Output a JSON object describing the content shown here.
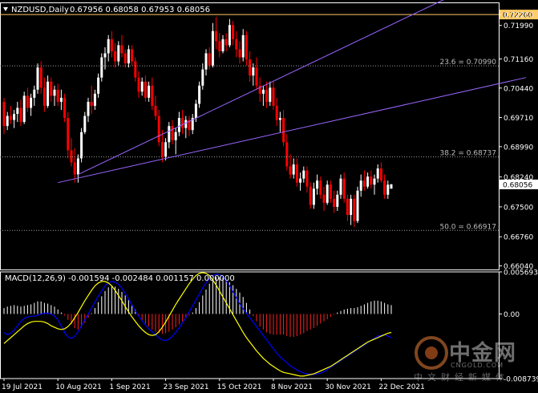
{
  "header": {
    "symbol_label": "NZDUSD,Daily",
    "ohlc_label": "0.67956 0.68058 0.67953 0.68056"
  },
  "macd_header": "MACD(12,26,9) -0.001594 -0.002484 0.001157 0.000000",
  "watermark": {
    "title": "中金网",
    "url": "CNGOLD.COM",
    "subtitle": "中文财经新媒体"
  },
  "colors": {
    "background": "#000000",
    "bull_candle": "#ffffff",
    "bear_candle": "#ff0000",
    "channel_line": "#9966ff",
    "resistance_line": "#ffcc66",
    "fib_line": "#a0a0a0",
    "macd_positive": "#ffffff",
    "macd_negative": "#ff2020",
    "macd_line": "#0000ff",
    "signal_line": "#ffff00",
    "axis_text": "#ffffff"
  },
  "chart_data": {
    "type": "candlestick",
    "price_axis": {
      "ticks": [
        "0.72260",
        "0.71990",
        "0.71160",
        "0.70440",
        "0.69710",
        "0.68990",
        "0.68240",
        "0.67500",
        "0.66760",
        "0.66040"
      ],
      "range": [
        0.6595,
        0.7254
      ]
    },
    "current_price": "0.68056",
    "resistance": {
      "value": 0.7226,
      "label": "0.72260"
    },
    "fib_levels": [
      {
        "label": "23.6 = 0.70990",
        "value": 0.7099
      },
      {
        "label": "38.2 = 0.68737",
        "value": 0.68737
      },
      {
        "label": "50.0 = 0.66917",
        "value": 0.66917
      }
    ],
    "date_labels": [
      "19 Jul 2021",
      "10 Aug 2021",
      "1 Sep 2021",
      "23 Sep 2021",
      "15 Oct 2021",
      "8 Nov 2021",
      "30 Nov 2021",
      "22 Dec 2021"
    ],
    "date_label_bars": [
      0,
      16,
      32,
      48,
      64,
      80,
      96,
      112
    ],
    "candles": [
      [
        0.701,
        0.702,
        0.693,
        0.695
      ],
      [
        0.695,
        0.6985,
        0.694,
        0.6975
      ],
      [
        0.6975,
        0.7,
        0.6955,
        0.6965
      ],
      [
        0.6965,
        0.699,
        0.6945,
        0.698
      ],
      [
        0.698,
        0.701,
        0.696,
        0.6995
      ],
      [
        0.6995,
        0.7015,
        0.695,
        0.696
      ],
      [
        0.696,
        0.7035,
        0.6955,
        0.7025
      ],
      [
        0.7025,
        0.7045,
        0.6985,
        0.6995
      ],
      [
        0.6995,
        0.703,
        0.6975,
        0.702
      ],
      [
        0.702,
        0.705,
        0.7,
        0.704
      ],
      [
        0.704,
        0.7105,
        0.703,
        0.7095
      ],
      [
        0.7095,
        0.711,
        0.703,
        0.7045
      ],
      [
        0.7045,
        0.707,
        0.6985,
        0.7
      ],
      [
        0.7,
        0.7075,
        0.6995,
        0.706
      ],
      [
        0.706,
        0.707,
        0.701,
        0.7025
      ],
      [
        0.7025,
        0.705,
        0.7,
        0.704
      ],
      [
        0.704,
        0.7055,
        0.7,
        0.701
      ],
      [
        0.701,
        0.704,
        0.699,
        0.702
      ],
      [
        0.702,
        0.703,
        0.696,
        0.697
      ],
      [
        0.697,
        0.6985,
        0.687,
        0.689
      ],
      [
        0.689,
        0.692,
        0.685,
        0.686
      ],
      [
        0.686,
        0.6895,
        0.681,
        0.683
      ],
      [
        0.683,
        0.688,
        0.681,
        0.687
      ],
      [
        0.687,
        0.6945,
        0.686,
        0.6935
      ],
      [
        0.6935,
        0.6985,
        0.693,
        0.6975
      ],
      [
        0.6975,
        0.702,
        0.696,
        0.701
      ],
      [
        0.701,
        0.705,
        0.698,
        0.7
      ],
      [
        0.7,
        0.704,
        0.699,
        0.703
      ],
      [
        0.703,
        0.708,
        0.702,
        0.707
      ],
      [
        0.707,
        0.713,
        0.706,
        0.712
      ],
      [
        0.712,
        0.7145,
        0.709,
        0.713
      ],
      [
        0.713,
        0.7175,
        0.711,
        0.7165
      ],
      [
        0.7165,
        0.7185,
        0.712,
        0.7135
      ],
      [
        0.7135,
        0.7155,
        0.7095,
        0.711
      ],
      [
        0.711,
        0.716,
        0.71,
        0.715
      ],
      [
        0.715,
        0.7175,
        0.712,
        0.713
      ],
      [
        0.713,
        0.714,
        0.7095,
        0.7105
      ],
      [
        0.7105,
        0.715,
        0.7095,
        0.714
      ],
      [
        0.714,
        0.715,
        0.71,
        0.711
      ],
      [
        0.711,
        0.712,
        0.706,
        0.707
      ],
      [
        0.707,
        0.7085,
        0.702,
        0.7035
      ],
      [
        0.7035,
        0.707,
        0.7025,
        0.706
      ],
      [
        0.706,
        0.7075,
        0.701,
        0.702
      ],
      [
        0.702,
        0.706,
        0.701,
        0.705
      ],
      [
        0.705,
        0.707,
        0.699,
        0.7
      ],
      [
        0.7,
        0.7025,
        0.6965,
        0.6975
      ],
      [
        0.6975,
        0.699,
        0.69,
        0.691
      ],
      [
        0.691,
        0.694,
        0.686,
        0.6875
      ],
      [
        0.6875,
        0.692,
        0.6865,
        0.691
      ],
      [
        0.691,
        0.696,
        0.6895,
        0.695
      ],
      [
        0.695,
        0.6965,
        0.6905,
        0.6915
      ],
      [
        0.6915,
        0.6945,
        0.688,
        0.6935
      ],
      [
        0.6935,
        0.6985,
        0.6925,
        0.697
      ],
      [
        0.697,
        0.699,
        0.693,
        0.6945
      ],
      [
        0.6945,
        0.6975,
        0.692,
        0.6965
      ],
      [
        0.6965,
        0.6975,
        0.6925,
        0.694
      ],
      [
        0.694,
        0.698,
        0.693,
        0.697
      ],
      [
        0.697,
        0.7015,
        0.696,
        0.7005
      ],
      [
        0.7005,
        0.706,
        0.6995,
        0.705
      ],
      [
        0.705,
        0.7105,
        0.704,
        0.709
      ],
      [
        0.709,
        0.714,
        0.7075,
        0.713
      ],
      [
        0.713,
        0.7145,
        0.709,
        0.71
      ],
      [
        0.71,
        0.7205,
        0.7095,
        0.7185
      ],
      [
        0.7185,
        0.722,
        0.714,
        0.716
      ],
      [
        0.716,
        0.718,
        0.712,
        0.7135
      ],
      [
        0.7135,
        0.7175,
        0.713,
        0.7165
      ],
      [
        0.7165,
        0.718,
        0.7135,
        0.715
      ],
      [
        0.715,
        0.7215,
        0.7145,
        0.72
      ],
      [
        0.72,
        0.721,
        0.715,
        0.7165
      ],
      [
        0.7165,
        0.7185,
        0.712,
        0.714
      ],
      [
        0.714,
        0.716,
        0.7105,
        0.712
      ],
      [
        0.712,
        0.719,
        0.711,
        0.7175
      ],
      [
        0.7175,
        0.7185,
        0.71,
        0.7115
      ],
      [
        0.7115,
        0.7135,
        0.706,
        0.7075
      ],
      [
        0.7075,
        0.7105,
        0.705,
        0.7095
      ],
      [
        0.7095,
        0.712,
        0.704,
        0.705
      ],
      [
        0.705,
        0.707,
        0.701,
        0.703
      ],
      [
        0.703,
        0.705,
        0.7,
        0.704
      ],
      [
        0.704,
        0.706,
        0.6995,
        0.701
      ],
      [
        0.701,
        0.706,
        0.7,
        0.7045
      ],
      [
        0.7045,
        0.706,
        0.699,
        0.7
      ],
      [
        0.7,
        0.702,
        0.695,
        0.6965
      ],
      [
        0.6965,
        0.6985,
        0.6935,
        0.697
      ],
      [
        0.697,
        0.699,
        0.69,
        0.691
      ],
      [
        0.691,
        0.693,
        0.684,
        0.685
      ],
      [
        0.685,
        0.688,
        0.682,
        0.683
      ],
      [
        0.683,
        0.687,
        0.682,
        0.6855
      ],
      [
        0.6855,
        0.687,
        0.68,
        0.681
      ],
      [
        0.681,
        0.6835,
        0.679,
        0.682
      ],
      [
        0.682,
        0.685,
        0.681,
        0.684
      ],
      [
        0.684,
        0.685,
        0.6785,
        0.68
      ],
      [
        0.68,
        0.681,
        0.6745,
        0.6755
      ],
      [
        0.6755,
        0.681,
        0.6745,
        0.6795
      ],
      [
        0.6795,
        0.683,
        0.678,
        0.6815
      ],
      [
        0.6815,
        0.6825,
        0.677,
        0.678
      ],
      [
        0.678,
        0.68,
        0.674,
        0.676
      ],
      [
        0.676,
        0.6815,
        0.6755,
        0.6805
      ],
      [
        0.6805,
        0.6815,
        0.676,
        0.677
      ],
      [
        0.677,
        0.679,
        0.6735,
        0.675
      ],
      [
        0.675,
        0.679,
        0.674,
        0.678
      ],
      [
        0.678,
        0.683,
        0.677,
        0.682
      ],
      [
        0.682,
        0.6835,
        0.676,
        0.677
      ],
      [
        0.677,
        0.678,
        0.6715,
        0.673
      ],
      [
        0.673,
        0.678,
        0.6705,
        0.677
      ],
      [
        0.677,
        0.678,
        0.67,
        0.6715
      ],
      [
        0.6715,
        0.68,
        0.671,
        0.679
      ],
      [
        0.679,
        0.683,
        0.6775,
        0.6815
      ],
      [
        0.6815,
        0.684,
        0.679,
        0.68
      ],
      [
        0.68,
        0.6835,
        0.6795,
        0.6825
      ],
      [
        0.6825,
        0.684,
        0.6795,
        0.6805
      ],
      [
        0.6805,
        0.683,
        0.678,
        0.682
      ],
      [
        0.682,
        0.6855,
        0.681,
        0.6845
      ],
      [
        0.6845,
        0.686,
        0.681,
        0.6815
      ],
      [
        0.6815,
        0.683,
        0.677,
        0.678
      ],
      [
        0.678,
        0.6815,
        0.677,
        0.6805
      ],
      [
        0.6795,
        0.6806,
        0.6795,
        0.6806
      ]
    ],
    "macd": {
      "axis_ticks": [
        "0.005693",
        "0.00",
        "-0.008739"
      ],
      "range": [
        -0.008739,
        0.005693
      ],
      "histogram": [
        0.0008,
        0.001,
        0.0011,
        0.0012,
        0.0011,
        0.001,
        0.0011,
        0.0012,
        0.0013,
        0.0015,
        0.0017,
        0.0017,
        0.0015,
        0.0014,
        0.0012,
        0.001,
        0.0006,
        0.0002,
        -0.0002,
        -0.0008,
        -0.0014,
        -0.0019,
        -0.0021,
        -0.0018,
        -0.0012,
        -0.0005,
        0.0001,
        0.0008,
        0.0016,
        0.0024,
        0.0031,
        0.0036,
        0.0038,
        0.0037,
        0.0034,
        0.003,
        0.0025,
        0.0019,
        0.0013,
        0.0006,
        -0.0002,
        -0.0008,
        -0.0013,
        -0.0017,
        -0.0021,
        -0.0024,
        -0.0026,
        -0.0027,
        -0.0026,
        -0.0024,
        -0.0021,
        -0.0018,
        -0.0014,
        -0.001,
        -0.0006,
        -0.0002,
        0.0002,
        0.0008,
        0.0016,
        0.0025,
        0.0033,
        0.0041,
        0.0047,
        0.005,
        0.005,
        0.0049,
        0.0046,
        0.0043,
        0.0039,
        0.0034,
        0.0029,
        0.0023,
        0.0015,
        0.0006,
        -0.0003,
        -0.001,
        -0.0017,
        -0.0021,
        -0.0025,
        -0.0027,
        -0.0028,
        -0.0028,
        -0.0028,
        -0.0028,
        -0.003,
        -0.0031,
        -0.0031,
        -0.003,
        -0.0028,
        -0.0026,
        -0.0023,
        -0.0021,
        -0.0019,
        -0.0016,
        -0.0013,
        -0.001,
        -0.0007,
        -0.0004,
        -0.0001,
        0.0002,
        0.0004,
        0.0006,
        0.0007,
        0.0008,
        0.0008,
        0.0009,
        0.0011,
        0.0013,
        0.0015,
        0.0017,
        0.0018,
        0.0018,
        0.0017,
        0.0015,
        0.0013,
        0.0012
      ],
      "macd_line": [
        -0.0025,
        -0.0028,
        -0.0026,
        -0.0022,
        -0.0016,
        -0.001,
        -0.0006,
        -0.0004,
        -0.0003,
        -0.0003,
        -0.0002,
        0.0,
        0.0001,
        0.0001,
        0.0,
        -0.0003,
        -0.0008,
        -0.0016,
        -0.0025,
        -0.0031,
        -0.0033,
        -0.003,
        -0.0024,
        -0.0016,
        -0.0008,
        0.0,
        0.0008,
        0.0016,
        0.0024,
        0.0031,
        0.0038,
        0.0042,
        0.0044,
        0.0043,
        0.004,
        0.0035,
        0.0028,
        0.002,
        0.0012,
        0.0004,
        -0.0003,
        -0.0009,
        -0.0015,
        -0.002,
        -0.0024,
        -0.0028,
        -0.0032,
        -0.0035,
        -0.0036,
        -0.0034,
        -0.003,
        -0.0025,
        -0.0019,
        -0.0012,
        -0.0005,
        0.0003,
        0.0011,
        0.0019,
        0.0027,
        0.0035,
        0.0042,
        0.0048,
        0.0052,
        0.0054,
        0.0053,
        0.005,
        0.0045,
        0.0038,
        0.003,
        0.0022,
        0.0014,
        0.0007,
        0.0001,
        -0.0005,
        -0.0011,
        -0.0017,
        -0.0023,
        -0.0029,
        -0.0035,
        -0.0041,
        -0.0047,
        -0.0053,
        -0.0058,
        -0.0062,
        -0.0066,
        -0.007,
        -0.0073,
        -0.0076,
        -0.0078,
        -0.008,
        -0.0081,
        -0.0082,
        -0.0082,
        -0.0081,
        -0.008,
        -0.0078,
        -0.0075,
        -0.0072,
        -0.0069,
        -0.0066,
        -0.0063,
        -0.006,
        -0.0057,
        -0.0054,
        -0.0051,
        -0.0048,
        -0.0045,
        -0.0042,
        -0.0039,
        -0.0036,
        -0.0033,
        -0.003,
        -0.0029,
        -0.0028,
        -0.003,
        -0.0032
      ],
      "signal_line": [
        -0.004,
        -0.0036,
        -0.0032,
        -0.0028,
        -0.0024,
        -0.002,
        -0.0016,
        -0.0013,
        -0.0011,
        -0.001,
        -0.001,
        -0.001,
        -0.0011,
        -0.0013,
        -0.0016,
        -0.0018,
        -0.002,
        -0.0021,
        -0.002,
        -0.0017,
        -0.0012,
        -0.0005,
        0.0002,
        0.001,
        0.0018,
        0.0025,
        0.0032,
        0.0038,
        0.0042,
        0.0044,
        0.0044,
        0.0042,
        0.0038,
        0.0032,
        0.0025,
        0.0018,
        0.001,
        0.0003,
        -0.0004,
        -0.001,
        -0.0016,
        -0.0021,
        -0.0025,
        -0.0028,
        -0.0029,
        -0.0028,
        -0.0024,
        -0.0018,
        -0.0011,
        -0.0003,
        0.0005,
        0.0013,
        0.002,
        0.0027,
        0.0034,
        0.0041,
        0.0047,
        0.0052,
        0.0055,
        0.0056,
        0.0055,
        0.0052,
        0.0046,
        0.0039,
        0.0031,
        0.0023,
        0.0015,
        0.0007,
        -0.0001,
        -0.0009,
        -0.0017,
        -0.0025,
        -0.0032,
        -0.0038,
        -0.0044,
        -0.005,
        -0.0055,
        -0.006,
        -0.0064,
        -0.0068,
        -0.0071,
        -0.0074,
        -0.0077,
        -0.0079,
        -0.008,
        -0.0081,
        -0.0082,
        -0.0083,
        -0.0084,
        -0.0084,
        -0.0083,
        -0.0082,
        -0.0081,
        -0.0079,
        -0.0077,
        -0.0075,
        -0.0073,
        -0.0071,
        -0.0068,
        -0.0065,
        -0.0062,
        -0.0059,
        -0.0056,
        -0.0053,
        -0.005,
        -0.0047,
        -0.0044,
        -0.0041,
        -0.0038,
        -0.0036,
        -0.0034,
        -0.0032,
        -0.003,
        -0.0028,
        -0.0026,
        -0.0025
      ]
    },
    "channel_lines": [
      {
        "from": {
          "bar": 22,
          "price": 0.683
        },
        "to": {
          "bar": 155,
          "price": 0.736
        }
      },
      {
        "from": {
          "bar": 16,
          "price": 0.681
        },
        "to": {
          "bar": 155,
          "price": 0.707
        }
      }
    ]
  }
}
